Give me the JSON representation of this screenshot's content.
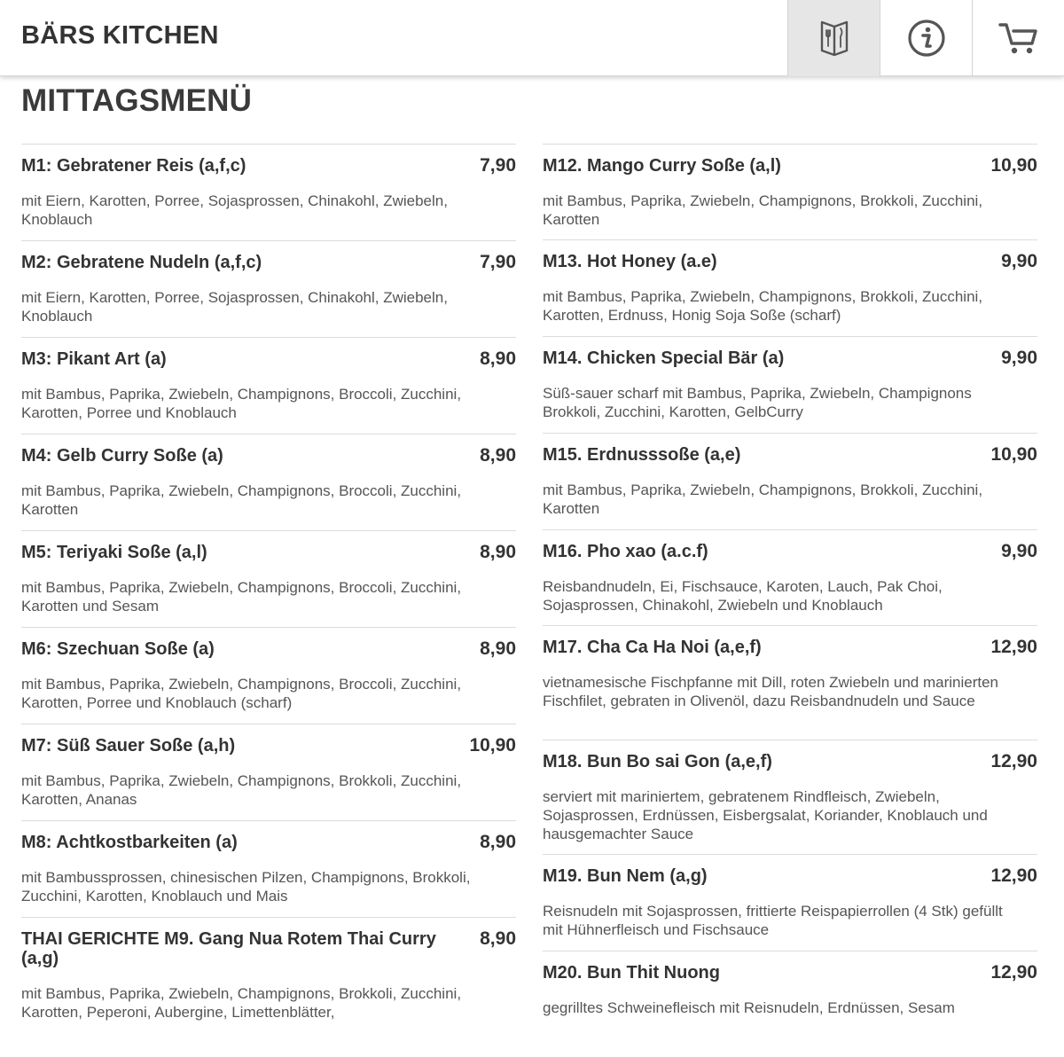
{
  "header": {
    "brand": "BÄRS KITCHEN",
    "icons": {
      "menu": "menu-book-icon",
      "info": "info-icon",
      "cart": "cart-icon"
    }
  },
  "page": {
    "title": "MITTAGSMENÜ"
  },
  "menu": {
    "left": [
      {
        "name": "M1: Gebratener Reis (a,f,c)",
        "price": "7,90",
        "desc": "mit Eiern, Karotten, Porree, Sojasprossen, Chinakohl, Zwiebeln, Knoblauch"
      },
      {
        "name": "M2: Gebratene Nudeln (a,f,c)",
        "price": "7,90",
        "desc": "mit Eiern, Karotten, Porree, Sojasprossen, Chinakohl, Zwiebeln, Knoblauch"
      },
      {
        "name": "M3: Pikant Art (a)",
        "price": "8,90",
        "desc": "mit Bambus, Paprika, Zwiebeln, Champignons, Broccoli, Zucchini, Karotten, Porree und Knoblauch"
      },
      {
        "name": "M4: Gelb Curry Soße (a)",
        "price": "8,90",
        "desc": "mit Bambus, Paprika, Zwiebeln, Champignons, Broccoli, Zucchini, Karotten"
      },
      {
        "name": "M5: Teriyaki Soße (a,l)",
        "price": "8,90",
        "desc": "mit Bambus, Paprika, Zwiebeln, Champignons, Broccoli, Zucchini, Karotten und Sesam"
      },
      {
        "name": "M6: Szechuan Soße (a)",
        "price": "8,90",
        "desc": "mit Bambus, Paprika, Zwiebeln, Champignons, Broccoli, Zucchini, Karotten, Porree und Knoblauch (scharf)"
      },
      {
        "name": "M7: Süß Sauer Soße (a,h)",
        "price": "10,90",
        "desc": "mit Bambus, Paprika, Zwiebeln, Champignons, Brokkoli, Zucchini, Karotten, Ananas"
      },
      {
        "name": "M8: Achtkostbarkeiten (a)",
        "price": "8,90",
        "desc": "mit Bambussprossen, chinesischen Pilzen, Champignons, Brokkoli, Zucchini, Karotten, Knoblauch und Mais"
      },
      {
        "name": "THAI GERICHTE M9. Gang Nua Rotem Thai Curry (a,g)",
        "price": "8,90",
        "desc": "mit Bambus, Paprika, Zwiebeln, Champignons, Brokkoli, Zucchini, Karotten, Peperoni, Aubergine, Limettenblätter,"
      }
    ],
    "right": [
      {
        "name": "M12. Mango Curry Soße (a,l)",
        "price": "10,90",
        "desc": "mit Bambus, Paprika, Zwiebeln, Champignons, Brokkoli, Zucchini, Karotten"
      },
      {
        "name": "M13. Hot Honey (a.e)",
        "price": "9,90",
        "desc": "mit Bambus, Paprika, Zwiebeln, Champignons, Brokkoli, Zucchini, Karotten, Erdnuss, Honig Soja Soße (scharf)"
      },
      {
        "name": "M14. Chicken Special Bär (a)",
        "price": "9,90",
        "desc": "Süß-sauer scharf mit Bambus, Paprika, Zwiebeln, Champignons Brokkoli, Zucchini, Karotten, GelbCurry"
      },
      {
        "name": "M15. Erdnusssoße (a,e)",
        "price": "10,90",
        "desc": "mit Bambus, Paprika, Zwiebeln, Champignons, Brokkoli, Zucchini, Karotten"
      },
      {
        "name": "M16. Pho xao (a.c.f)",
        "price": "9,90",
        "desc": "Reisbandnudeln, Ei, Fischsauce, Karoten, Lauch, Pak Choi, Sojasprossen, Chinakohl, Zwiebeln und Knoblauch"
      },
      {
        "name": "M17. Cha Ca Ha Noi (a,e,f)",
        "price": "12,90",
        "desc": "vietnamesische Fischpfanne mit Dill, roten Zwiebeln und marinierten Fischfilet, gebraten in Olivenöl, dazu Reisbandnudeln und Sauce"
      },
      {
        "name": "M18. Bun Bo sai Gon (a,e,f)",
        "price": "12,90",
        "desc": "serviert mit mariniertem, gebratenem Rindfleisch, Zwiebeln, Sojasprossen, Erdnüssen, Eisbergsalat, Koriander, Knoblauch und hausgemachter Sauce"
      },
      {
        "name": "M19. Bun Nem (a,g)",
        "price": "12,90",
        "desc": "Reisnudeln mit Sojasprossen, frittierte Reispapierrollen (4 Stk) gefüllt mit Hühnerfleisch und Fischsauce"
      },
      {
        "name": "M20. Bun Thit Nuong",
        "price": "12,90",
        "desc": "gegrilltes Schweinefleisch mit Reisnudeln, Erdnüssen, Sesam"
      }
    ]
  }
}
